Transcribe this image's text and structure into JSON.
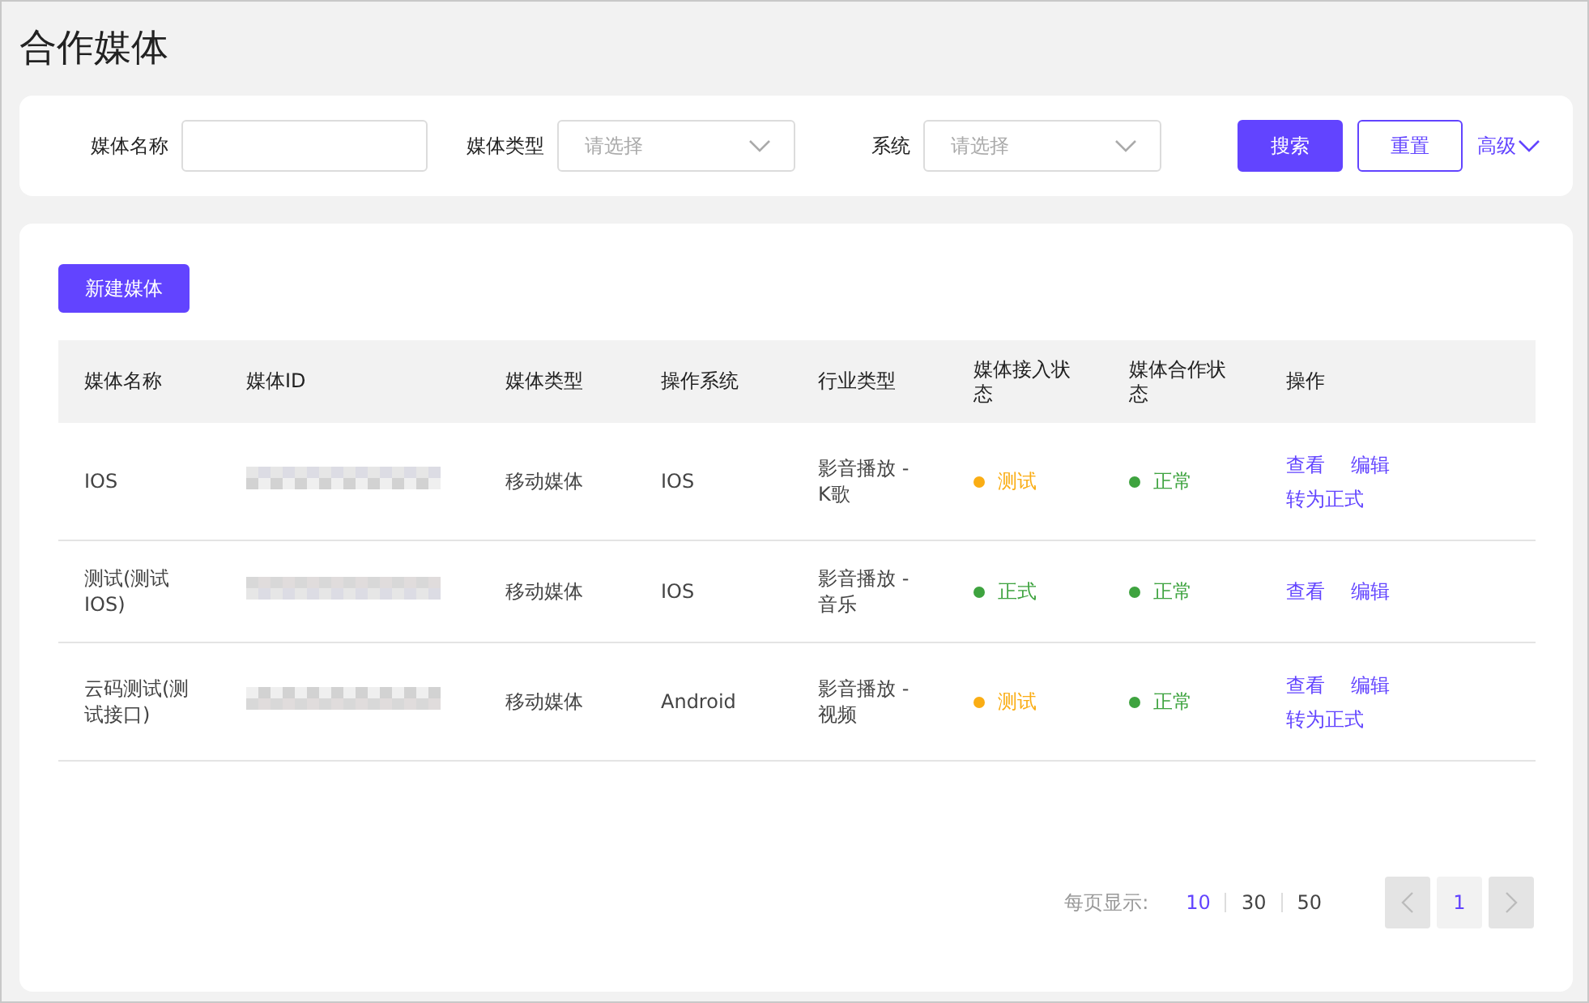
{
  "page_title": "合作媒体",
  "filters": [
    {
      "kind": "input",
      "label": "媒体名称"
    },
    {
      "kind": "select",
      "label": "媒体类型",
      "placeholder": "请选择"
    },
    {
      "kind": "select",
      "label": "系统",
      "placeholder": "请选择"
    }
  ],
  "search_button": "搜索",
  "reset_button": "重置",
  "advanced_link": "高级",
  "new_button": "新建媒体",
  "table": {
    "columns": [
      "媒体名称",
      "媒体ID",
      "媒体类型",
      "操作系统",
      "行业类型",
      "媒体接入状态",
      "媒体合作状态",
      "操作"
    ],
    "rows": [
      {
        "name": "IOS",
        "media_type": "移动媒体",
        "os": "IOS",
        "industry": "影音播放 - K歌",
        "access": {
          "text": "测试",
          "color": "#faad14"
        },
        "coop": {
          "text": "正常",
          "color": "#3ea33f"
        },
        "actions": [
          "查看",
          "编辑",
          "转为正式"
        ]
      },
      {
        "name": "测试(测试IOS)",
        "media_type": "移动媒体",
        "os": "IOS",
        "industry": "影音播放 - 音乐",
        "access": {
          "text": "正式",
          "color": "#3ea33f"
        },
        "coop": {
          "text": "正常",
          "color": "#3ea33f"
        },
        "actions": [
          "查看",
          "编辑"
        ]
      },
      {
        "name": "云码测试(测试接口)",
        "media_type": "移动媒体",
        "os": "Android",
        "industry": "影音播放 - 视频",
        "access": {
          "text": "测试",
          "color": "#faad14"
        },
        "coop": {
          "text": "正常",
          "color": "#3ea33f"
        },
        "actions": [
          "查看",
          "编辑",
          "转为正式"
        ]
      }
    ]
  },
  "pagination": {
    "label": "每页显示:",
    "sizes": [
      {
        "text": "10",
        "selected": true
      },
      {
        "text": "30",
        "selected": false
      },
      {
        "text": "50",
        "selected": false
      }
    ],
    "pages": [
      {
        "text": "1",
        "selected": true
      }
    ]
  }
}
